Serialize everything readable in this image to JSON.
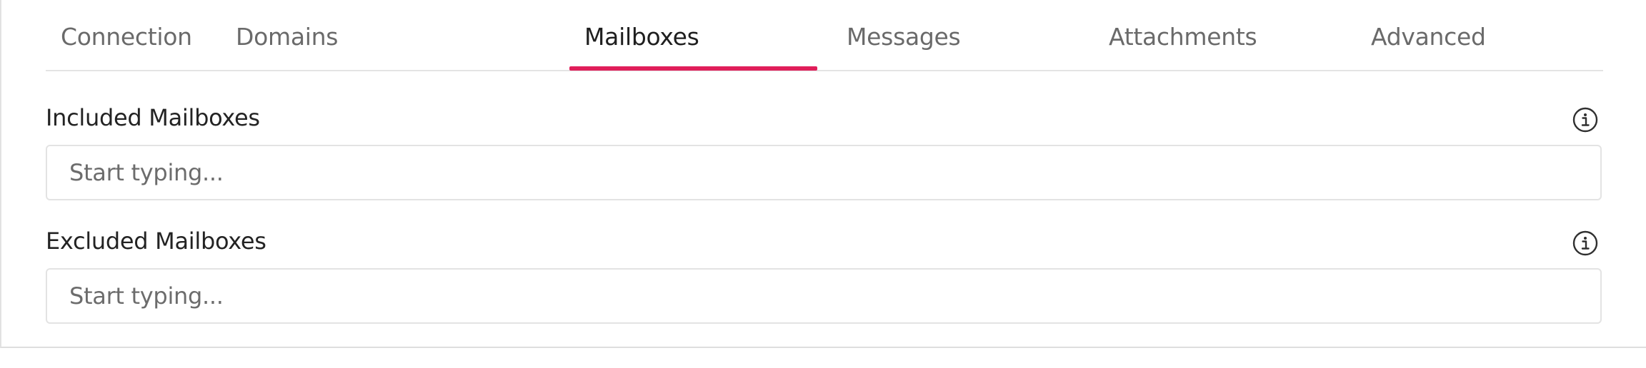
{
  "tabs": [
    {
      "label": "Connection",
      "active": false
    },
    {
      "label": "Domains",
      "active": false
    },
    {
      "label": "Mailboxes",
      "active": true
    },
    {
      "label": "Messages",
      "active": false
    },
    {
      "label": "Attachments",
      "active": false
    },
    {
      "label": "Advanced",
      "active": false
    }
  ],
  "fields": {
    "included": {
      "label": "Included Mailboxes",
      "placeholder": "Start typing...",
      "value": "",
      "info_icon": "info-icon"
    },
    "excluded": {
      "label": "Excluded Mailboxes",
      "placeholder": "Start typing...",
      "value": "",
      "info_icon": "info-icon"
    }
  },
  "colors": {
    "accent": "#e01e5a",
    "tab_inactive": "#6a6a6a",
    "tab_active": "#1f1f1f",
    "border": "#e3e3e3"
  }
}
